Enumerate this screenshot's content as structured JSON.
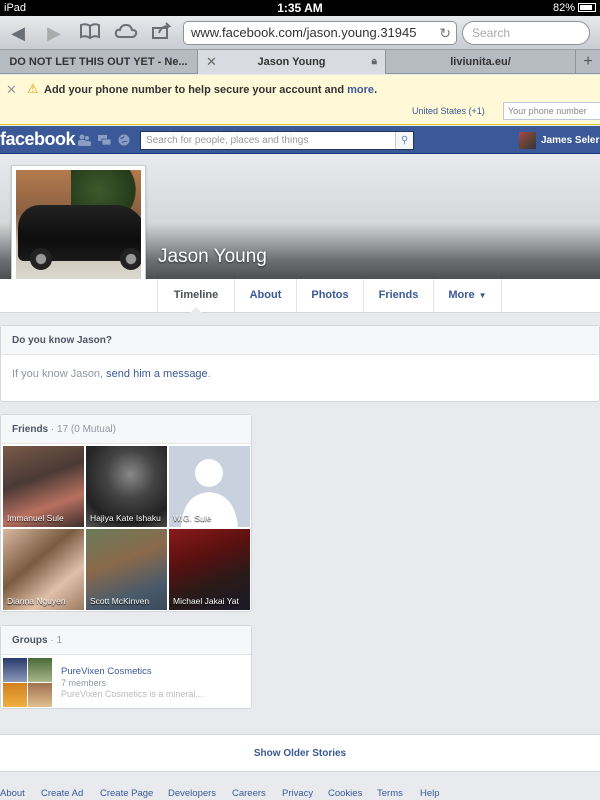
{
  "status_bar": {
    "device": "iPad",
    "time": "1:35 AM",
    "battery": "82%"
  },
  "browser": {
    "url": "www.facebook.com/jason.young.31945",
    "search_placeholder": "Search",
    "tabs": [
      {
        "label": "DO NOT LET THIS OUT YET - Ne..."
      },
      {
        "label": "Jason Young"
      },
      {
        "label": "liviunita.eu/"
      }
    ]
  },
  "banner": {
    "message": "Add your phone number to help secure your account and",
    "more_link": "more",
    "country": "United States (+1)",
    "phone_placeholder": "Your phone number"
  },
  "fb_header": {
    "logo": "facebook",
    "search_placeholder": "Search for people, places and things",
    "user_name": "James Seler"
  },
  "profile": {
    "name": "Jason Young",
    "tabs": [
      "Timeline",
      "About",
      "Photos",
      "Friends",
      "More"
    ]
  },
  "know": {
    "title": "Do you know Jason?",
    "text_prefix": "If you know Jason,",
    "link": "send him a message",
    "suffix": "."
  },
  "friends": {
    "title": "Friends",
    "count": "· 17 (0 Mutual)",
    "list": [
      {
        "name": "Immanuel Sule"
      },
      {
        "name": "Hajiya Kate Ishaku"
      },
      {
        "name": "W.G. Sule"
      },
      {
        "name": "Dianna Nguyen"
      },
      {
        "name": "Scott McKinven"
      },
      {
        "name": "Michael Jakai Yat"
      }
    ]
  },
  "groups": {
    "title": "Groups",
    "count": "· 1",
    "items": [
      {
        "name": "PureVixen Cosmetics",
        "members": "7 members",
        "description": "PureVixen Cosmetics is a mineral..."
      }
    ]
  },
  "older_stories": "Show Older Stories",
  "footer": [
    "About",
    "Create Ad",
    "Create Page",
    "Developers",
    "Careers",
    "Privacy",
    "Cookies",
    "Terms",
    "Help"
  ]
}
